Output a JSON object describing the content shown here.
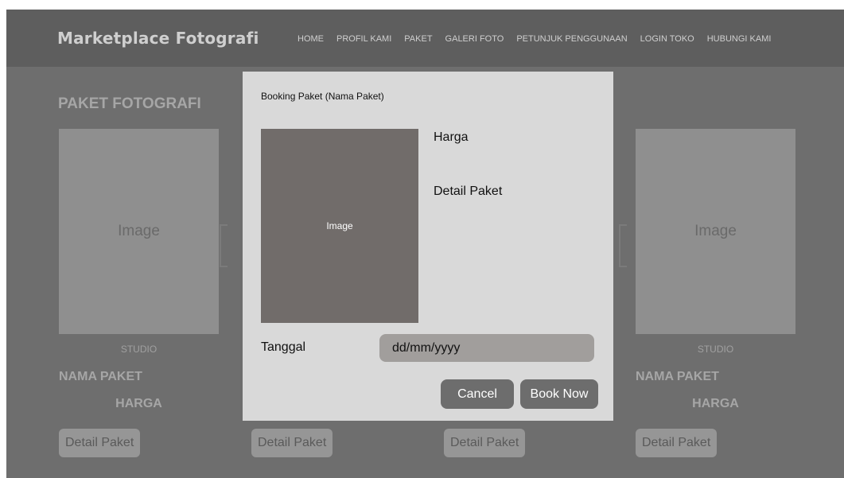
{
  "header": {
    "brand": "Marketplace Fotografi",
    "nav": [
      "HOME",
      "PROFIL KAMI",
      "PAKET",
      "GALERI FOTO",
      "PETUNJUK PENGGUNAAN",
      "LOGIN TOKO",
      "HUBUNGI KAMI"
    ]
  },
  "section": {
    "title": "PAKET FOTOGRAFI",
    "cards": [
      {
        "image_label": "Image",
        "studio": "STUDIO",
        "name": "NAMA PAKET",
        "price": "HARGA"
      },
      {
        "image_label": "Image",
        "studio": "STUDIO",
        "name": "NAMA PAKET",
        "price": "HARGA"
      }
    ],
    "detail_buttons": [
      "Detail Paket",
      "Detail Paket",
      "Detail Paket",
      "Detail Paket"
    ]
  },
  "modal": {
    "title": "Booking Paket (Nama Paket)",
    "image_label": "Image",
    "price_label": "Harga",
    "detail_label": "Detail Paket",
    "date_label": "Tanggal",
    "date_placeholder": "dd/mm/yyyy",
    "cancel_label": "Cancel",
    "book_label": "Book Now"
  }
}
